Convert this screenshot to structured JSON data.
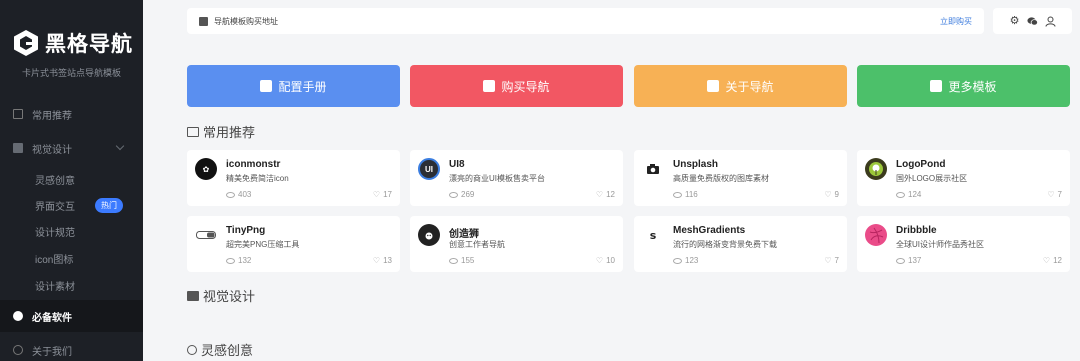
{
  "sidebar": {
    "logo_text": "黑格导航",
    "tagline": "卡片式书签站点导航模板",
    "items": [
      {
        "label": "常用推荐"
      },
      {
        "label": "视觉设计"
      },
      {
        "label": "灵感创意"
      },
      {
        "label": "界面交互",
        "badge": "热门"
      },
      {
        "label": "设计规范"
      },
      {
        "label": "icon图标"
      },
      {
        "label": "设计素材"
      },
      {
        "label": "必备软件"
      },
      {
        "label": "关于我们"
      }
    ]
  },
  "topbar": {
    "notice": "导航模板购买地址",
    "buy_link": "立即购买"
  },
  "buttons": [
    {
      "label": "配置手册",
      "color": "#5a8ff0"
    },
    {
      "label": "购买导航",
      "color": "#f25763"
    },
    {
      "label": "关于导航",
      "color": "#f7b155"
    },
    {
      "label": "更多模板",
      "color": "#4cc06a"
    }
  ],
  "sections": {
    "common": "常用推荐",
    "visual": "视觉设计",
    "inspiration": "灵感创意"
  },
  "cards": [
    {
      "name": "iconmonstr",
      "desc": "精美免费简洁icon",
      "views": "403",
      "likes": "17",
      "icon": "iconmonstr-logo",
      "icon_color": "#111"
    },
    {
      "name": "UI8",
      "desc": "漂亮的商业UI模板售卖平台",
      "views": "269",
      "likes": "12",
      "icon": "ui8-logo",
      "icon_color": "#2a2e35"
    },
    {
      "name": "Unsplash",
      "desc": "高质量免费版权的图库素材",
      "views": "116",
      "likes": "9",
      "icon": "camera-icon",
      "icon_color": "#fff"
    },
    {
      "name": "LogoPond",
      "desc": "国外LOGO展示社区",
      "views": "124",
      "likes": "7",
      "icon": "logopond-logo",
      "icon_color": "#3b3b1d"
    },
    {
      "name": "TinyPng",
      "desc": "超完美PNG压缩工具",
      "views": "132",
      "likes": "13",
      "icon": "tinypng-logo",
      "icon_color": "#fff"
    },
    {
      "name": "创造狮",
      "desc": "创意工作者导航",
      "views": "155",
      "likes": "10",
      "icon": "lion-logo",
      "icon_color": "#222"
    },
    {
      "name": "MeshGradients",
      "desc": "流行的网格渐变背景免费下载",
      "views": "123",
      "likes": "7",
      "icon": "mesh-logo",
      "icon_color": "#fff"
    },
    {
      "name": "Dribbble",
      "desc": "全球UI设计师作品秀社区",
      "views": "137",
      "likes": "12",
      "icon": "dribbble-logo",
      "icon_color": "#ea4c89"
    }
  ]
}
